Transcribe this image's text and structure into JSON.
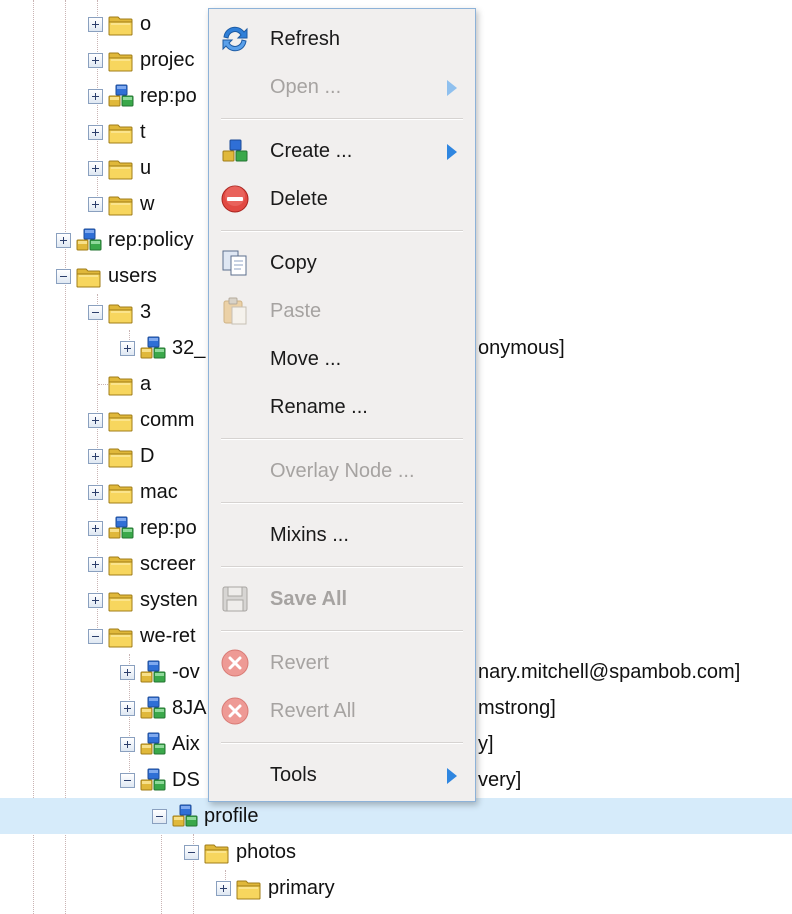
{
  "tree": {
    "nodes": [
      {
        "label": "o",
        "icon": "folder-icon",
        "expander": "plus"
      },
      {
        "label": "projec",
        "icon": "folder-icon",
        "expander": "plus"
      },
      {
        "label": "rep:po",
        "icon": "policy-icon",
        "expander": "plus"
      },
      {
        "label": "t",
        "icon": "folder-icon",
        "expander": "plus"
      },
      {
        "label": "u",
        "icon": "folder-icon",
        "expander": "plus"
      },
      {
        "label": "w",
        "icon": "folder-icon",
        "expander": "plus"
      },
      {
        "label": "rep:policy",
        "icon": "policy-icon",
        "expander": "plus"
      },
      {
        "label": "users",
        "icon": "folder-icon",
        "expander": "minus"
      },
      {
        "label": "3",
        "icon": "folder-icon",
        "expander": "minus"
      },
      {
        "label": "32_",
        "icon": "user-icon",
        "expander": "plus",
        "suffix": "onymous]"
      },
      {
        "label": "a",
        "icon": "folder-icon",
        "expander": "none"
      },
      {
        "label": "comm",
        "icon": "folder-icon",
        "expander": "plus"
      },
      {
        "label": "D",
        "icon": "folder-icon",
        "expander": "plus"
      },
      {
        "label": "mac",
        "icon": "folder-icon",
        "expander": "plus"
      },
      {
        "label": "rep:po",
        "icon": "policy-icon",
        "expander": "plus"
      },
      {
        "label": "screer",
        "icon": "folder-icon",
        "expander": "plus"
      },
      {
        "label": "systen",
        "icon": "folder-icon",
        "expander": "plus"
      },
      {
        "label": "we-ret",
        "icon": "folder-icon",
        "expander": "minus"
      },
      {
        "label": "-ov",
        "icon": "user-icon",
        "expander": "plus",
        "suffix": "nary.mitchell@spambob.com]"
      },
      {
        "label": "8JA",
        "icon": "user-icon",
        "expander": "plus",
        "suffix": "mstrong]"
      },
      {
        "label": "Aix",
        "icon": "user-icon",
        "expander": "plus",
        "suffix": "y]"
      },
      {
        "label": "DS",
        "icon": "user-icon",
        "expander": "minus",
        "suffix": "very]"
      },
      {
        "label": "profile",
        "icon": "user-icon",
        "expander": "minus"
      },
      {
        "label": "photos",
        "icon": "folder-icon",
        "expander": "minus"
      },
      {
        "label": "primary",
        "icon": "folder-icon",
        "expander": "plus"
      }
    ]
  },
  "context_menu": {
    "items": [
      {
        "label": "Refresh",
        "icon": "refresh-icon",
        "disabled": false
      },
      {
        "label": "Open ...",
        "icon": "",
        "disabled": true,
        "submenu": true
      },
      {
        "label": "Create ...",
        "icon": "create-node-icon",
        "disabled": false,
        "submenu": true
      },
      {
        "label": "Delete",
        "icon": "delete-icon",
        "disabled": false
      },
      {
        "label": "Copy",
        "icon": "copy-icon",
        "disabled": false
      },
      {
        "label": "Paste",
        "icon": "paste-icon",
        "disabled": true
      },
      {
        "label": "Move ...",
        "icon": "",
        "disabled": false
      },
      {
        "label": "Rename ...",
        "icon": "",
        "disabled": false
      },
      {
        "label": "Overlay Node ...",
        "icon": "",
        "disabled": true
      },
      {
        "label": "Mixins ...",
        "icon": "",
        "disabled": false
      },
      {
        "label": "Save All",
        "icon": "save-icon",
        "disabled": true,
        "bold": true
      },
      {
        "label": "Revert",
        "icon": "revert-icon",
        "disabled": true
      },
      {
        "label": "Revert All",
        "icon": "revert-all-icon",
        "disabled": true
      },
      {
        "label": "Tools",
        "icon": "",
        "disabled": false,
        "submenu": true
      }
    ]
  },
  "colors": {
    "selection": "#d6ebfa",
    "menu_background": "#f1efee",
    "menu_border": "#8db2d8",
    "submenu_arrow": "#2f86e0"
  }
}
